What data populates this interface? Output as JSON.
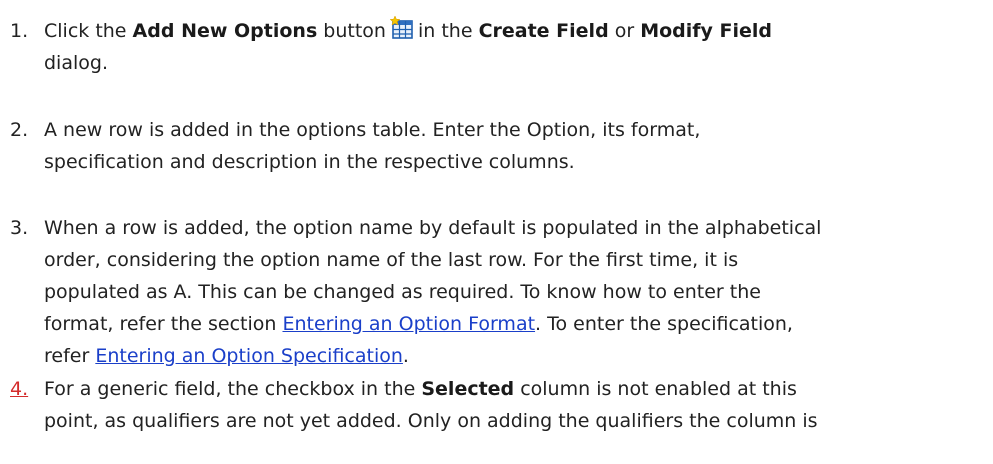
{
  "steps": [
    {
      "number": "1.",
      "t1": "Click the ",
      "b1": "Add New Options",
      "t2": " button",
      "t3": "in the ",
      "b2": "Create Field",
      "t4": " or ",
      "b3": "Modify Field",
      "t5": "dialog.",
      "icon": "add-new-options-icon"
    },
    {
      "number": "2.",
      "l1": "A new row is added in the options table. Enter the Option, its format,",
      "l2": "specification and description in the respective columns."
    },
    {
      "number": "3.",
      "l1": "When a row is added, the option name by default is populated in the alphabetical",
      "l2": "order, considering the option name of the last row. For the first time, it is",
      "l3": "populated as A. This can be changed as required. To know how to enter the",
      "l4a": "format, refer the section ",
      "link1": "Entering an Option Format",
      "l4b": ". To enter the specification,",
      "l5a": "refer ",
      "link2": "Entering an Option Specification",
      "l5b": "."
    },
    {
      "number": "4.",
      "t1": "For a generic field, the checkbox in the ",
      "b1": "Selected",
      "t2": " column is not enabled at this",
      "l2": "point, as qualifiers are not yet added. Only on adding the qualifiers the column is"
    }
  ],
  "colors": {
    "text": "#222222",
    "link": "#1a3fc9",
    "step4_number": "#d42b2b",
    "icon_grid": "#1f5fae",
    "icon_star": "#f5c400"
  }
}
